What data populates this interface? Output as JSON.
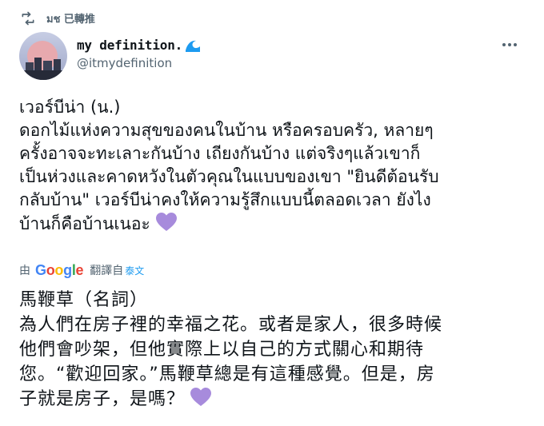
{
  "retweet": {
    "icon": "retweet-icon",
    "label": "มช 已轉推"
  },
  "author": {
    "avatar_icon": "moon-city-avatar",
    "display_name": "my definition.",
    "name_emoji": "wave-icon",
    "handle": "@itmydefinition"
  },
  "more_icon": "more-horizontal-icon",
  "tweet": {
    "text": "เวอร์บีน่า (น.)\nดอกไม้แห่งความสุขของคนในบ้าน หรือครอบครัว, หลายๆ\nครั้งอาจจะทะเลาะกันบ้าง เถียงกันบ้าง แต่จริงๆแล้วเขาก็\nเป็นห่วงและคาดหวังในตัวคุณในแบบของเขา \"ยินดีต้อนรับ\nกลับบ้าน\" เวอร์บีน่าคงให้ความรู้สึกแบบนี้ตลอดเวลา ยังไง\nบ้านก็คือบ้านเนอะ",
    "emoji": "purple-heart-icon"
  },
  "translation": {
    "by_label": "由",
    "provider": "Google",
    "translated_from": "翻譯自",
    "source_language": "泰文",
    "text": "馬鞭草（名詞）\n為人們在房子裡的幸福之花。或者是家人，很多時候\n他們會吵架，但他實際上以自己的方式關心和期待\n您。“歡迎回家。”馬鞭草總是有這種感覺。但是，房\n子就是房子，是嗎？",
    "emoji": "purple-heart-icon"
  },
  "colors": {
    "text_primary": "#0f1419",
    "text_secondary": "#536471",
    "link": "#1d9bf0",
    "heart": "#a78bdc"
  }
}
